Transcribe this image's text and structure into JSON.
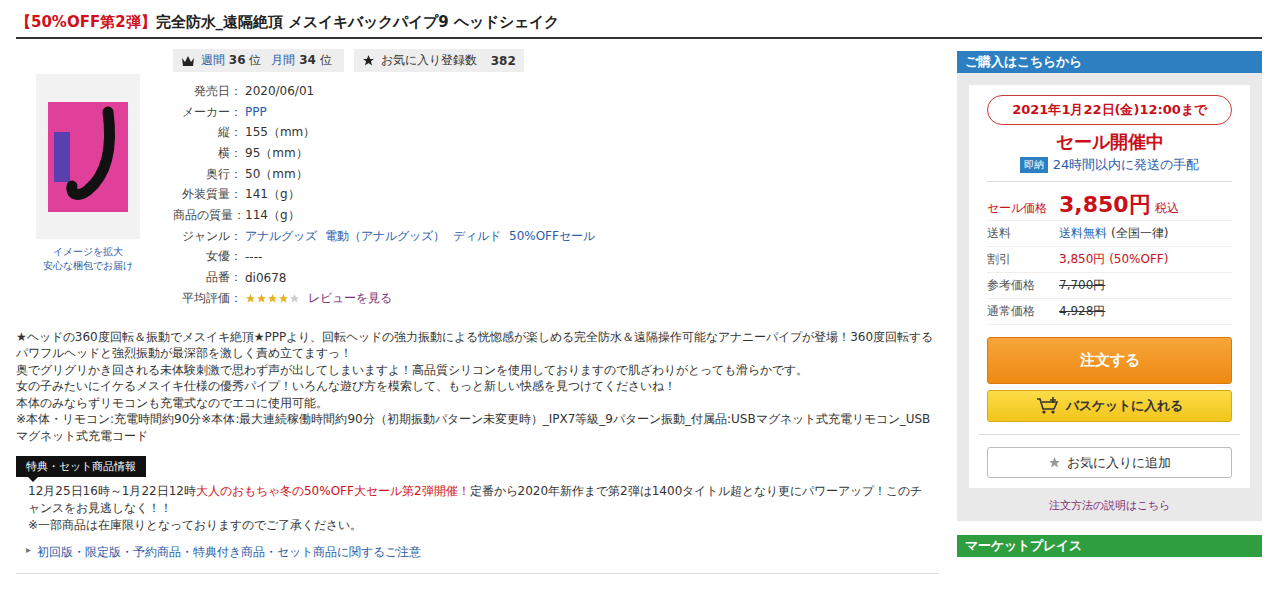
{
  "title": {
    "tag": "【50%OFF第2弾】",
    "name": "完全防水_遠隔絶頂 メスイキバックパイプ9 ヘッドシェイク"
  },
  "image_links": [
    "イメージを拡大",
    "安心な梱包でお届け"
  ],
  "rankings": [
    {
      "label": "週間",
      "value": "36",
      "unit": "位"
    },
    {
      "label": "月間",
      "value": "34",
      "unit": "位"
    }
  ],
  "favorites": {
    "label": "お気に入り登録数",
    "count": "382"
  },
  "specs": [
    {
      "label": "発売日",
      "values": [
        {
          "text": "2020/06/01",
          "link": false
        }
      ]
    },
    {
      "label": "メーカー",
      "values": [
        {
          "text": "PPP",
          "link": true
        }
      ]
    },
    {
      "label": "縦",
      "values": [
        {
          "text": "155（mm）",
          "link": false
        }
      ]
    },
    {
      "label": "横",
      "values": [
        {
          "text": "95（mm）",
          "link": false
        }
      ]
    },
    {
      "label": "奥行",
      "values": [
        {
          "text": "50（mm）",
          "link": false
        }
      ]
    },
    {
      "label": "外装質量",
      "values": [
        {
          "text": "141（g）",
          "link": false
        }
      ]
    },
    {
      "label": "商品の質量",
      "values": [
        {
          "text": "114（g）",
          "link": false
        }
      ]
    },
    {
      "label": "ジャンル",
      "values": [
        {
          "text": "アナルグッズ",
          "link": true
        },
        {
          "text": "電動（アナルグッズ）",
          "link": true
        },
        {
          "text": "ディルド",
          "link": true
        },
        {
          "text": "50%OFFセール",
          "link": true
        }
      ]
    },
    {
      "label": "女優",
      "values": [
        {
          "text": "----",
          "link": false
        }
      ]
    },
    {
      "label": "品番",
      "values": [
        {
          "text": "di0678",
          "link": false
        }
      ]
    }
  ],
  "rating": {
    "label": "平均評価",
    "stars": 4,
    "link": "レビューを見る"
  },
  "description": [
    "★ヘッドの360度回転＆振動でメスイキ絶頂★PPPより、回転ヘッドの強力振動による恍惚感が楽しめる完全防水＆遠隔操作可能なアナニーパイプが登場！360度回転するパワフルヘッドと強烈振動が最深部を激しく責め立てますっ！",
    "奥でグリグリかき回される未体験刺激で思わず声が出してしまいますよ！高品質シリコンを使用しておりますので肌ざわりがとっても滑らかです。",
    "女の子みたいにイケるメスイキ仕様の優秀パイプ！いろんな遊び方を模索して、もっと新しい快感を見つけてくださいね！",
    "本体のみならずリモコンも充電式なのでエコに使用可能。",
    "※本体・リモコン:充電時間約90分※本体:最大連続稼働時間約90分（初期振動パターン未変更時）_IPX7等級_9パターン振動_付属品:USBマグネット式充電リモコン_USBマグネット式充電コード"
  ],
  "special": {
    "tab": "特典・セット商品情報",
    "date": "12月25日16時～1月22日12時",
    "highlight": "大人のおもちゃ冬の50%OFF大セール第2弾開催！",
    "text": "定番から2020年新作まで第2弾は1400タイトル超となり更にパワーアップ！このチャンスをお見逃しなく！！",
    "note": "※一部商品は在庫限りとなっておりますのでご了承ください。"
  },
  "notice_link": {
    "icon": "▸",
    "text": "初回版・限定版・予約商品・特典付き商品・セット商品に関するご注意"
  },
  "purchase": {
    "header": "ご購入はこちらから",
    "deadline": "2021年1月22日(金)12:00まで",
    "sale_status": "セール開催中",
    "shipping_badge": "即納",
    "shipping_text": "24時間以内に発送の手配",
    "rows": [
      {
        "kind": "sale",
        "label": "セール価格",
        "value": "3,850円",
        "suffix": "税込"
      },
      {
        "kind": "link",
        "label": "送料",
        "value": "送料無料",
        "suffix": "(全国一律)"
      },
      {
        "kind": "discount",
        "label": "割引",
        "value": "3,850円 (50%OFF)",
        "suffix": ""
      },
      {
        "kind": "strike",
        "label": "参考価格",
        "value": "7,700円",
        "suffix": ""
      },
      {
        "kind": "strike",
        "label": "通常価格",
        "value": "4,928円",
        "suffix": ""
      }
    ],
    "order_button": "注文する",
    "basket_button": "バスケットに入れる",
    "favorite_button": "お気に入りに追加",
    "help_link": "注文方法の説明はこちら"
  },
  "marketplace": {
    "title": "マーケットプレイス"
  }
}
